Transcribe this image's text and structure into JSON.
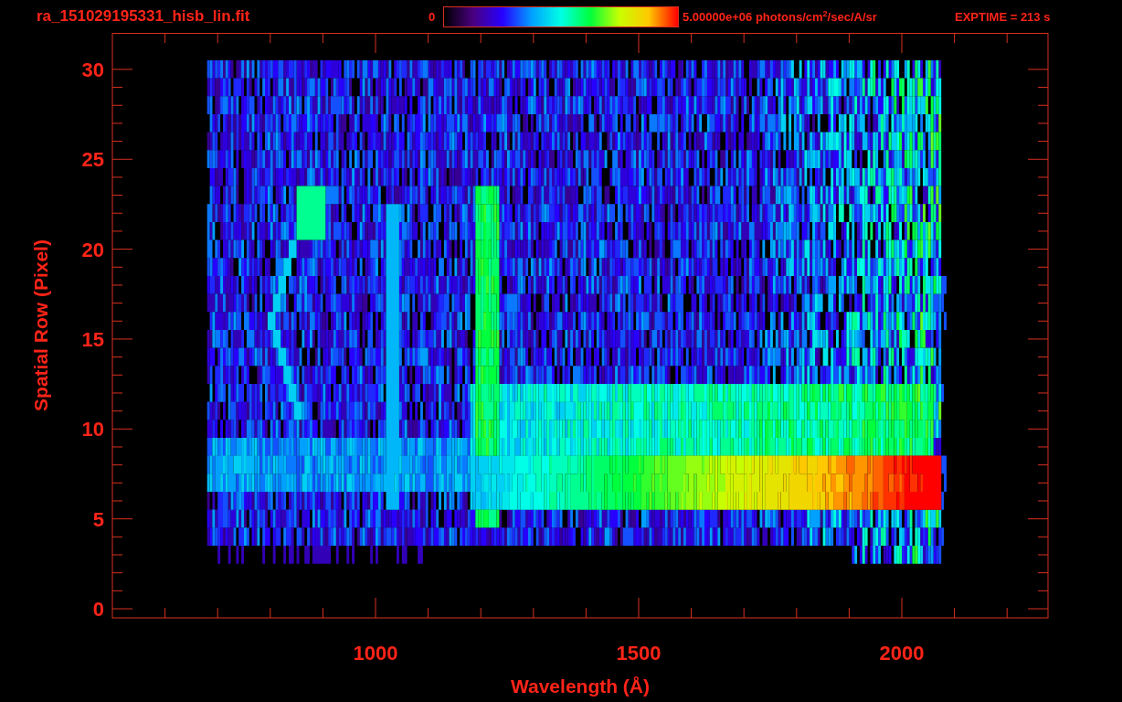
{
  "header": {
    "title": "ra_151029195331_hisb_lin.fit",
    "colorbar_min": "0",
    "colorbar_max": "5.00000e+06 photons/cm$^{2}$/sec/A/sr",
    "exptime": "EXPTIME = 213 s"
  },
  "plot": {
    "ylabel": "Spatial Row (Pixel)",
    "xlabel": "Wavelength (Å)",
    "yticks": [
      "30",
      "25",
      "20",
      "15",
      "10",
      "5",
      "0"
    ],
    "xticks": [
      "1000",
      "1500",
      "2000"
    ]
  }
}
